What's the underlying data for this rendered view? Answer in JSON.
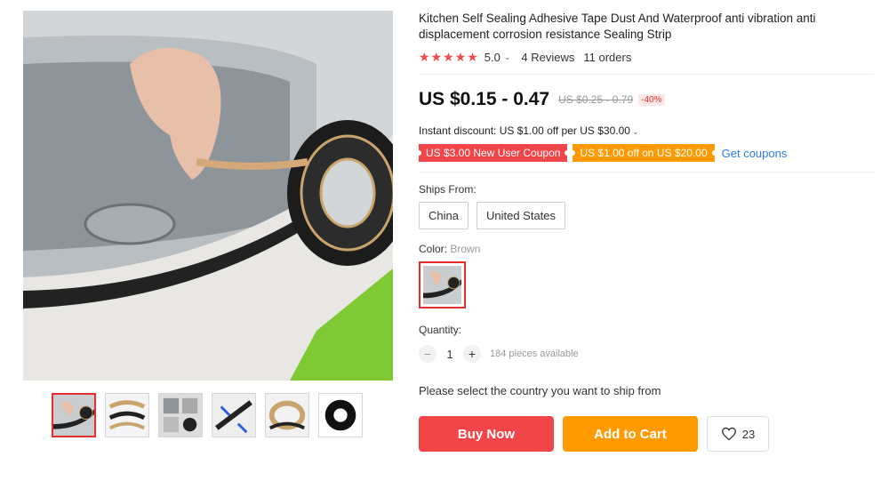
{
  "product": {
    "title": "Kitchen Self Sealing Adhesive Tape Dust And Waterproof anti vibration anti displacement corrosion resistance Sealing Strip",
    "rating": "5.0",
    "stars": "★★★★★",
    "reviews": "4 Reviews",
    "orders": "11 orders"
  },
  "price": {
    "current": "US $0.15 - 0.47",
    "original": "US $0.25 - 0.79",
    "discount": "-40%"
  },
  "instant_discount": "Instant discount: US $1.00 off per US $30.00",
  "coupons": [
    {
      "label": "US $3.00 New User Coupon"
    },
    {
      "label": "US $1.00 off on US $20.00"
    }
  ],
  "get_coupons": "Get coupons",
  "ships_from": {
    "label": "Ships From:",
    "options": [
      "China",
      "United States"
    ]
  },
  "color": {
    "label": "Color:",
    "selected": "Brown"
  },
  "quantity": {
    "label": "Quantity:",
    "minus": "−",
    "plus": "+",
    "value": "1",
    "available": "184 pieces available"
  },
  "ship_note": "Please select the country you want to ship from",
  "actions": {
    "buy": "Buy Now",
    "cart": "Add to Cart",
    "wishlist_count": "23"
  },
  "icons": {
    "chevron": "chevron-down-icon",
    "heart": "heart-icon"
  },
  "colors": {
    "accent_red": "#f2454a",
    "accent_orange": "#ff9a00",
    "link_blue": "#2c7be5",
    "star": "#f04a4a"
  }
}
